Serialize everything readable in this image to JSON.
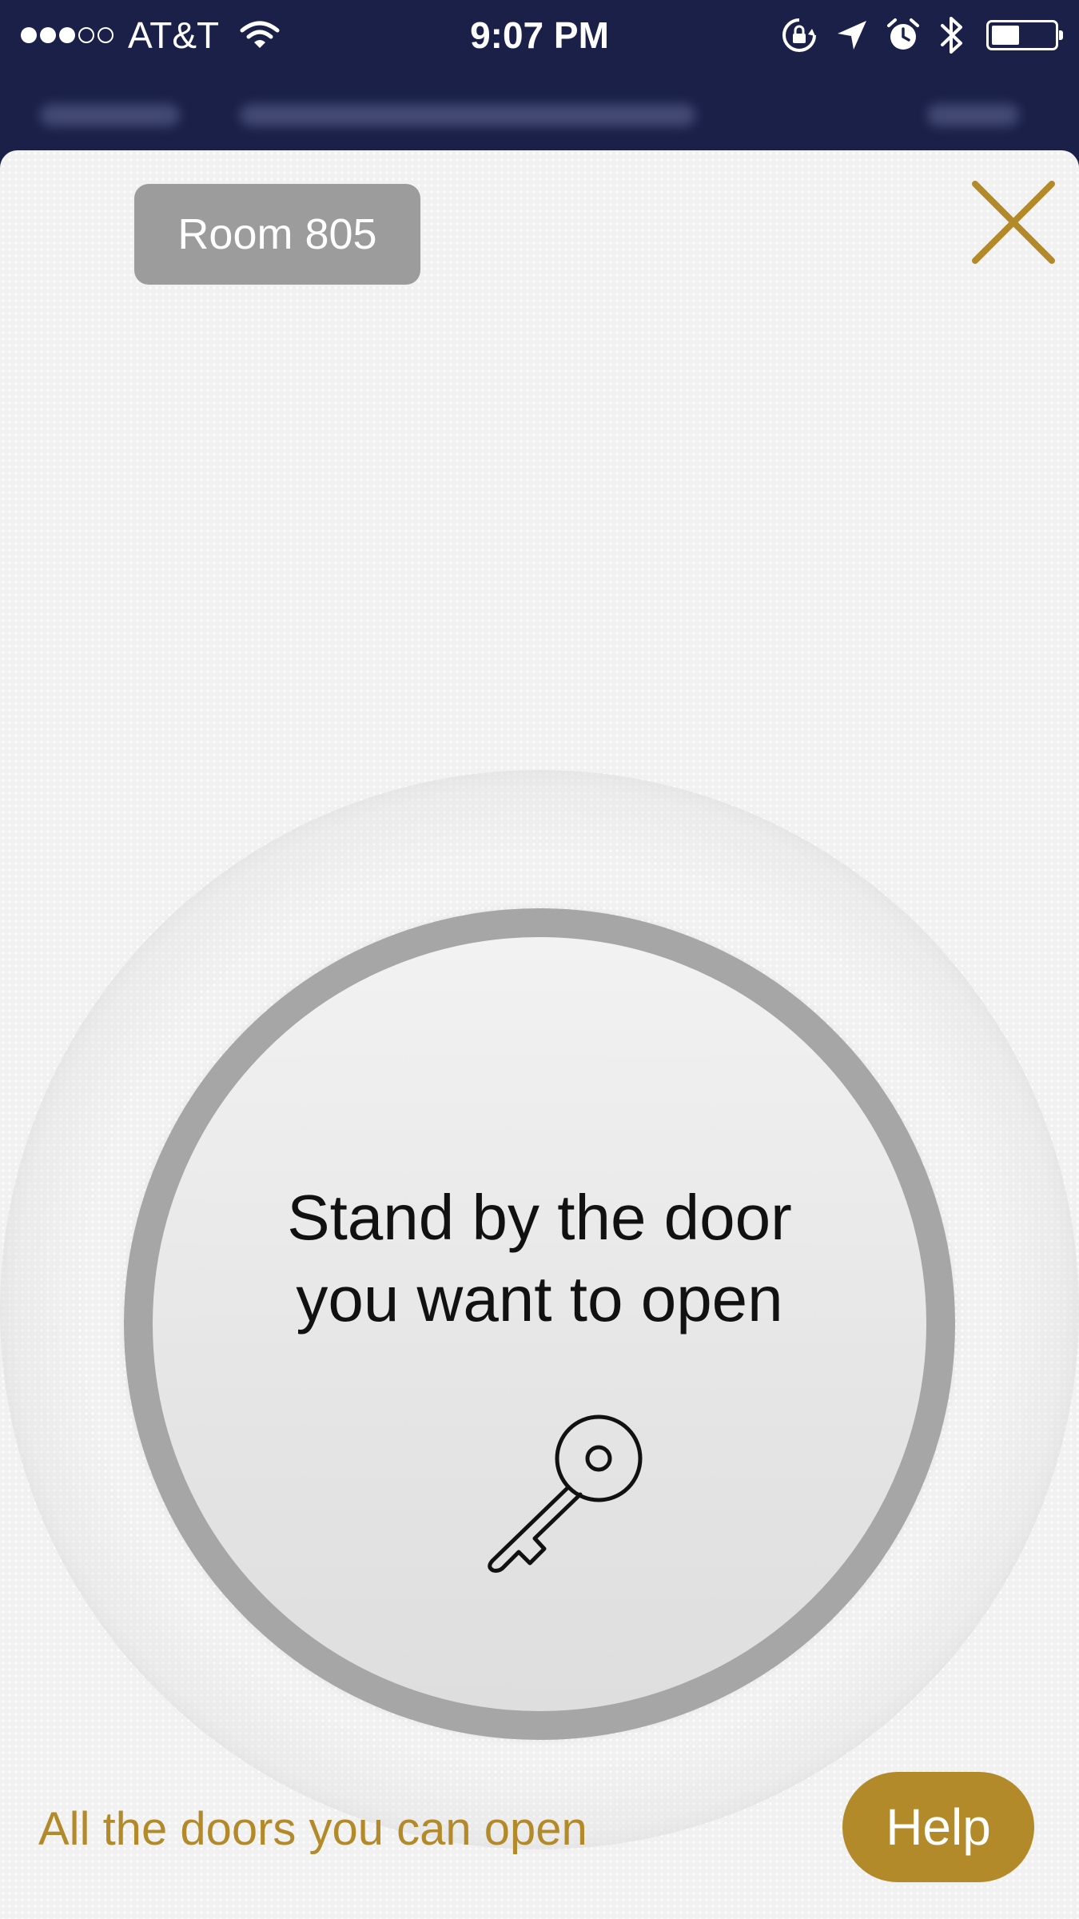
{
  "status_bar": {
    "carrier": "AT&T",
    "time": "9:07 PM",
    "signal_bars_filled": 3,
    "signal_bars_total": 5,
    "battery_level": 0.45,
    "icons": [
      "signal-icon",
      "wifi-icon",
      "rotation-lock-icon",
      "location-icon",
      "alarm-icon",
      "bluetooth-icon",
      "battery-icon"
    ]
  },
  "sheet": {
    "room_label": "Room 805",
    "close_icon": "close-icon",
    "instruction_line1": "Stand by the door",
    "instruction_line2": "you want to open",
    "key_icon": "key-icon",
    "doors_link": "All the doors you can open",
    "help_label": "Help"
  },
  "colors": {
    "accent_gold": "#b38a2a",
    "nav_bg": "#1a2048",
    "chip_gray": "#9c9c9c",
    "ring_gray": "#a6a6a6"
  }
}
